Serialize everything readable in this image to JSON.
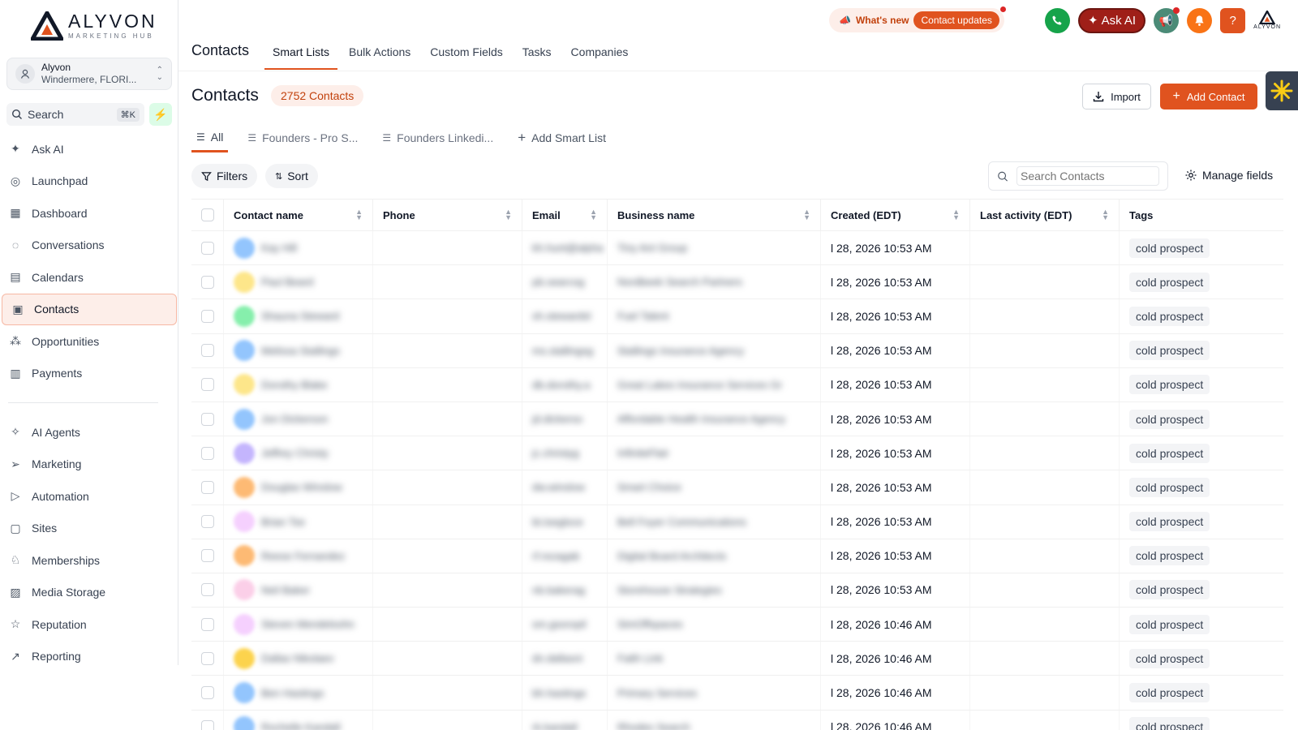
{
  "brand": {
    "name": "ALYVON",
    "sub": "MARKETING HUB",
    "accent": "#e0531f"
  },
  "account": {
    "name": "Alyvon",
    "location": "Windermere, FLORI..."
  },
  "sidebar_search": {
    "label": "Search",
    "shortcut": "⌘K"
  },
  "nav": {
    "top": [
      {
        "label": "Ask AI",
        "icon": "sparkle-icon"
      },
      {
        "label": "Launchpad",
        "icon": "rocket-icon"
      },
      {
        "label": "Dashboard",
        "icon": "grid-icon"
      },
      {
        "label": "Conversations",
        "icon": "chat-icon"
      },
      {
        "label": "Calendars",
        "icon": "calendar-icon"
      },
      {
        "label": "Contacts",
        "icon": "contacts-icon",
        "active": true
      },
      {
        "label": "Opportunities",
        "icon": "pipeline-icon"
      },
      {
        "label": "Payments",
        "icon": "receipt-icon"
      }
    ],
    "bottom": [
      {
        "label": "AI Agents",
        "icon": "agent-icon"
      },
      {
        "label": "Marketing",
        "icon": "send-icon"
      },
      {
        "label": "Automation",
        "icon": "play-circle-icon"
      },
      {
        "label": "Sites",
        "icon": "globe-icon"
      },
      {
        "label": "Memberships",
        "icon": "badge-icon"
      },
      {
        "label": "Media Storage",
        "icon": "image-icon"
      },
      {
        "label": "Reputation",
        "icon": "star-icon"
      },
      {
        "label": "Reporting",
        "icon": "trend-icon"
      }
    ]
  },
  "topbar": {
    "whats_new": "What's new",
    "contact_updates": "Contact updates",
    "ask_ai": "Ask AI",
    "help": "?"
  },
  "header": {
    "section": "Contacts",
    "tabs": [
      "Smart Lists",
      "Bulk Actions",
      "Custom Fields",
      "Tasks",
      "Companies"
    ],
    "active_tab": "Smart Lists"
  },
  "main": {
    "title": "Contacts",
    "count": "2752 Contacts",
    "import_label": "Import",
    "add_label": "Add Contact",
    "list_tabs": [
      "All",
      "Founders - Pro S...",
      "Founders Linkedi..."
    ],
    "add_list": "Add Smart List",
    "filters": "Filters",
    "sort": "Sort",
    "search_placeholder": "Search Contacts",
    "manage_fields": "Manage fields"
  },
  "table": {
    "columns": [
      "Contact name",
      "Phone",
      "Email",
      "Business name",
      "Created (EDT)",
      "Last activity (EDT)",
      "Tags"
    ],
    "rows": [
      {
        "avatar": "#93c5fd",
        "name": "Kay Hill",
        "email": "kh.hunt@alpha",
        "business": "Tiny Ant Group",
        "created": "l 28, 2026 10:53 AM",
        "tag": "cold prospect"
      },
      {
        "avatar": "#fde68a",
        "name": "Paul Beard",
        "email": "pb.searcog",
        "business": "Nordbeek Search Partners",
        "created": "l 28, 2026 10:53 AM",
        "tag": "cold prospect"
      },
      {
        "avatar": "#86efac",
        "name": "Shauna Steward",
        "email": "sh.stewardsl",
        "business": "Fuel Talent",
        "created": "l 28, 2026 10:53 AM",
        "tag": "cold prospect"
      },
      {
        "avatar": "#93c5fd",
        "name": "Melissa Stallings",
        "email": "ms.stallingsg",
        "business": "Stallings Insurance Agency",
        "created": "l 28, 2026 10:53 AM",
        "tag": "cold prospect"
      },
      {
        "avatar": "#fde68a",
        "name": "Dorothy Blake",
        "email": "db.dorothy.a",
        "business": "Great Lakes Insurance Services Gr",
        "created": "l 28, 2026 10:53 AM",
        "tag": "cold prospect"
      },
      {
        "avatar": "#93c5fd",
        "name": "Jon Dickerson",
        "email": "jd.dickerso",
        "business": "Affordable Health Insurance Agency",
        "created": "l 28, 2026 10:53 AM",
        "tag": "cold prospect"
      },
      {
        "avatar": "#c4b5fd",
        "name": "Jeffrey Christy",
        "email": "jc.christyg",
        "business": "InfiniteFlair",
        "created": "l 28, 2026 10:53 AM",
        "tag": "cold prospect"
      },
      {
        "avatar": "#fdba74",
        "name": "Douglas Winslow",
        "email": "dw.winslow",
        "business": "Smart Choice",
        "created": "l 28, 2026 10:53 AM",
        "tag": "cold prospect"
      },
      {
        "avatar": "#f5d0fe",
        "name": "Brian Tse",
        "email": "bt.tsegloce",
        "business": "Bell Foyer Communications",
        "created": "l 28, 2026 10:53 AM",
        "tag": "cold prospect"
      },
      {
        "avatar": "#fdba74",
        "name": "Reese Fernandez",
        "email": "rf.rezagab",
        "business": "Digital Board Architects",
        "created": "l 28, 2026 10:53 AM",
        "tag": "cold prospect"
      },
      {
        "avatar": "#fbcfe8",
        "name": "Neil Baker",
        "email": "nb.bakerag",
        "business": "Storehouse Strategies",
        "created": "l 28, 2026 10:53 AM",
        "tag": "cold prospect"
      },
      {
        "avatar": "#f5d0fe",
        "name": "Steven Mendelsohn",
        "email": "sm.gsoropil",
        "business": "SimOffspaces",
        "created": "l 28, 2026 10:46 AM",
        "tag": "cold prospect"
      },
      {
        "avatar": "#fcd34d",
        "name": "Dallas Nikolaev",
        "email": "dn.dallasni",
        "business": "Faith Link",
        "created": "l 28, 2026 10:46 AM",
        "tag": "cold prospect"
      },
      {
        "avatar": "#93c5fd",
        "name": "Ben Hastings",
        "email": "bh.hastings",
        "business": "Primary Services",
        "created": "l 28, 2026 10:46 AM",
        "tag": "cold prospect"
      },
      {
        "avatar": "#93c5fd",
        "name": "Rochelle Kandall",
        "email": "rk.kandall",
        "business": "Rhodes Search",
        "created": "l 28, 2026 10:46 AM",
        "tag": "cold prospect"
      }
    ]
  }
}
